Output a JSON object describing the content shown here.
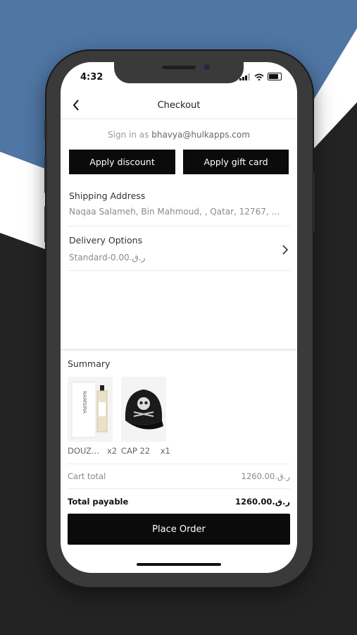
{
  "status": {
    "time": "4:32"
  },
  "header": {
    "title": "Checkout"
  },
  "signin": {
    "prefix": "Sign in as ",
    "email": "bhavya@hulkapps.com"
  },
  "actions": {
    "discount": "Apply discount",
    "gift_card": "Apply gift card"
  },
  "shipping": {
    "label": "Shipping Address",
    "value": "Naqaa Salameh, Bin Mahmoud, , Qatar, 12767, Ad..."
  },
  "delivery": {
    "label": "Delivery Options",
    "value": "Standard-0.00.ر.ق"
  },
  "summary": {
    "label": "Summary",
    "items": [
      {
        "name": "DOUZ...",
        "qty": "x2",
        "thumb_text": "NAMSIRA"
      },
      {
        "name": "CAP 22",
        "qty": "x1"
      }
    ],
    "cart_total_label": "Cart total",
    "cart_total_value": "1260.00.ر.ق",
    "total_payable_label": "Total payable",
    "total_payable_value": "1260.00.ر.ق"
  },
  "place_order": "Place Order",
  "colors": {
    "accent_blue": "#4f76a4",
    "background_dark": "#232323",
    "button_black": "#0b0b0b"
  }
}
